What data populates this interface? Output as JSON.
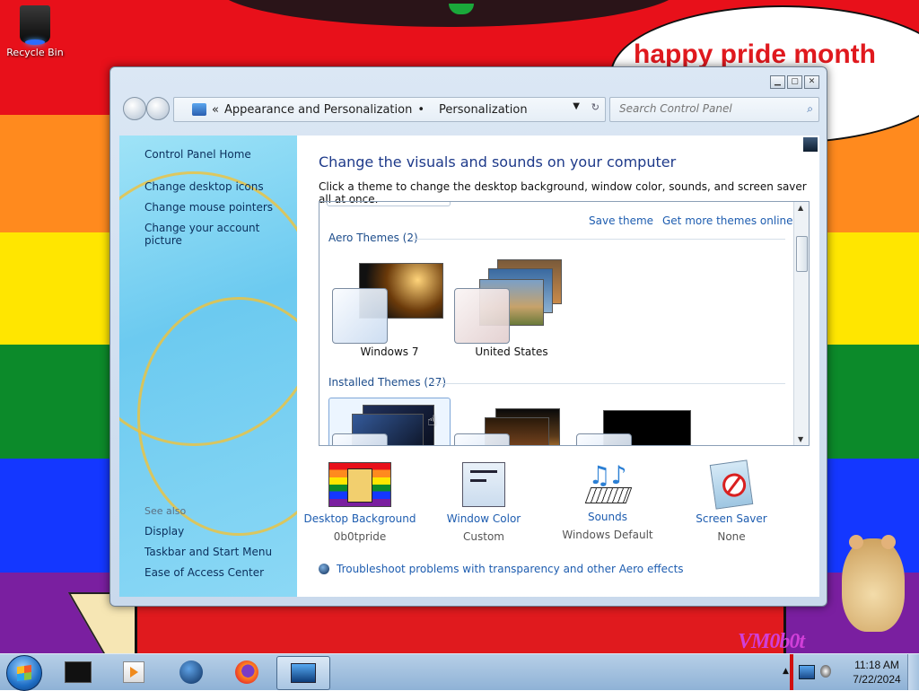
{
  "desktop": {
    "speech_text": "happy pride month",
    "watermark": "VM0b0t",
    "icons": [
      {
        "label": "Recycle Bin",
        "icon": "recycle-bin-icon"
      }
    ]
  },
  "window": {
    "nav": {
      "breadcrumb_overflow": "«",
      "breadcrumb": [
        "Appearance and Personalization",
        "Personalization"
      ],
      "separator": "•",
      "search_placeholder": "Search Control Panel"
    },
    "caption_buttons": [
      "minimize",
      "maximize",
      "close"
    ],
    "left_pane": {
      "home": "Control Panel Home",
      "links": [
        "Change desktop icons",
        "Change mouse pointers",
        "Change your account picture"
      ],
      "see_also_label": "See also",
      "see_also": [
        "Display",
        "Taskbar and Start Menu",
        "Ease of Access Center"
      ]
    },
    "main": {
      "title": "Change the visuals and sounds on your computer",
      "subtitle": "Click a theme to change the desktop background, window color, sounds, and screen saver all at once.",
      "gallery": {
        "save_theme": "Save theme",
        "get_more": "Get more themes online",
        "aero_header": "Aero Themes (2)",
        "aero_themes": [
          {
            "name": "Windows 7"
          },
          {
            "name": "United States"
          }
        ],
        "installed_header": "Installed Themes (27)"
      },
      "customize": [
        {
          "label": "Desktop Background",
          "value": "0b0tpride"
        },
        {
          "label": "Window Color",
          "value": "Custom"
        },
        {
          "label": "Sounds",
          "value": "Windows Default"
        },
        {
          "label": "Screen Saver",
          "value": "None"
        }
      ],
      "troubleshoot": "Troubleshoot problems with transparency and other Aero effects"
    }
  },
  "taskbar": {
    "apps": [
      "command-prompt-icon",
      "media-player-icon",
      "globe-browser-icon",
      "firefox-icon",
      "control-panel-icon"
    ],
    "active_app": "control-panel-icon",
    "clock": {
      "time": "11:18 AM",
      "date": "7/22/2024"
    }
  },
  "colors": {
    "link": "#1e5db0",
    "title": "#1e3a8a",
    "left_link": "#0b2f5c",
    "pride_red": "#e8101a",
    "pride_orange": "#ff8a1e",
    "pride_yellow": "#ffe600",
    "pride_green": "#0c8a2a",
    "pride_blue": "#1437ff",
    "pride_purple": "#7a1fa0"
  }
}
